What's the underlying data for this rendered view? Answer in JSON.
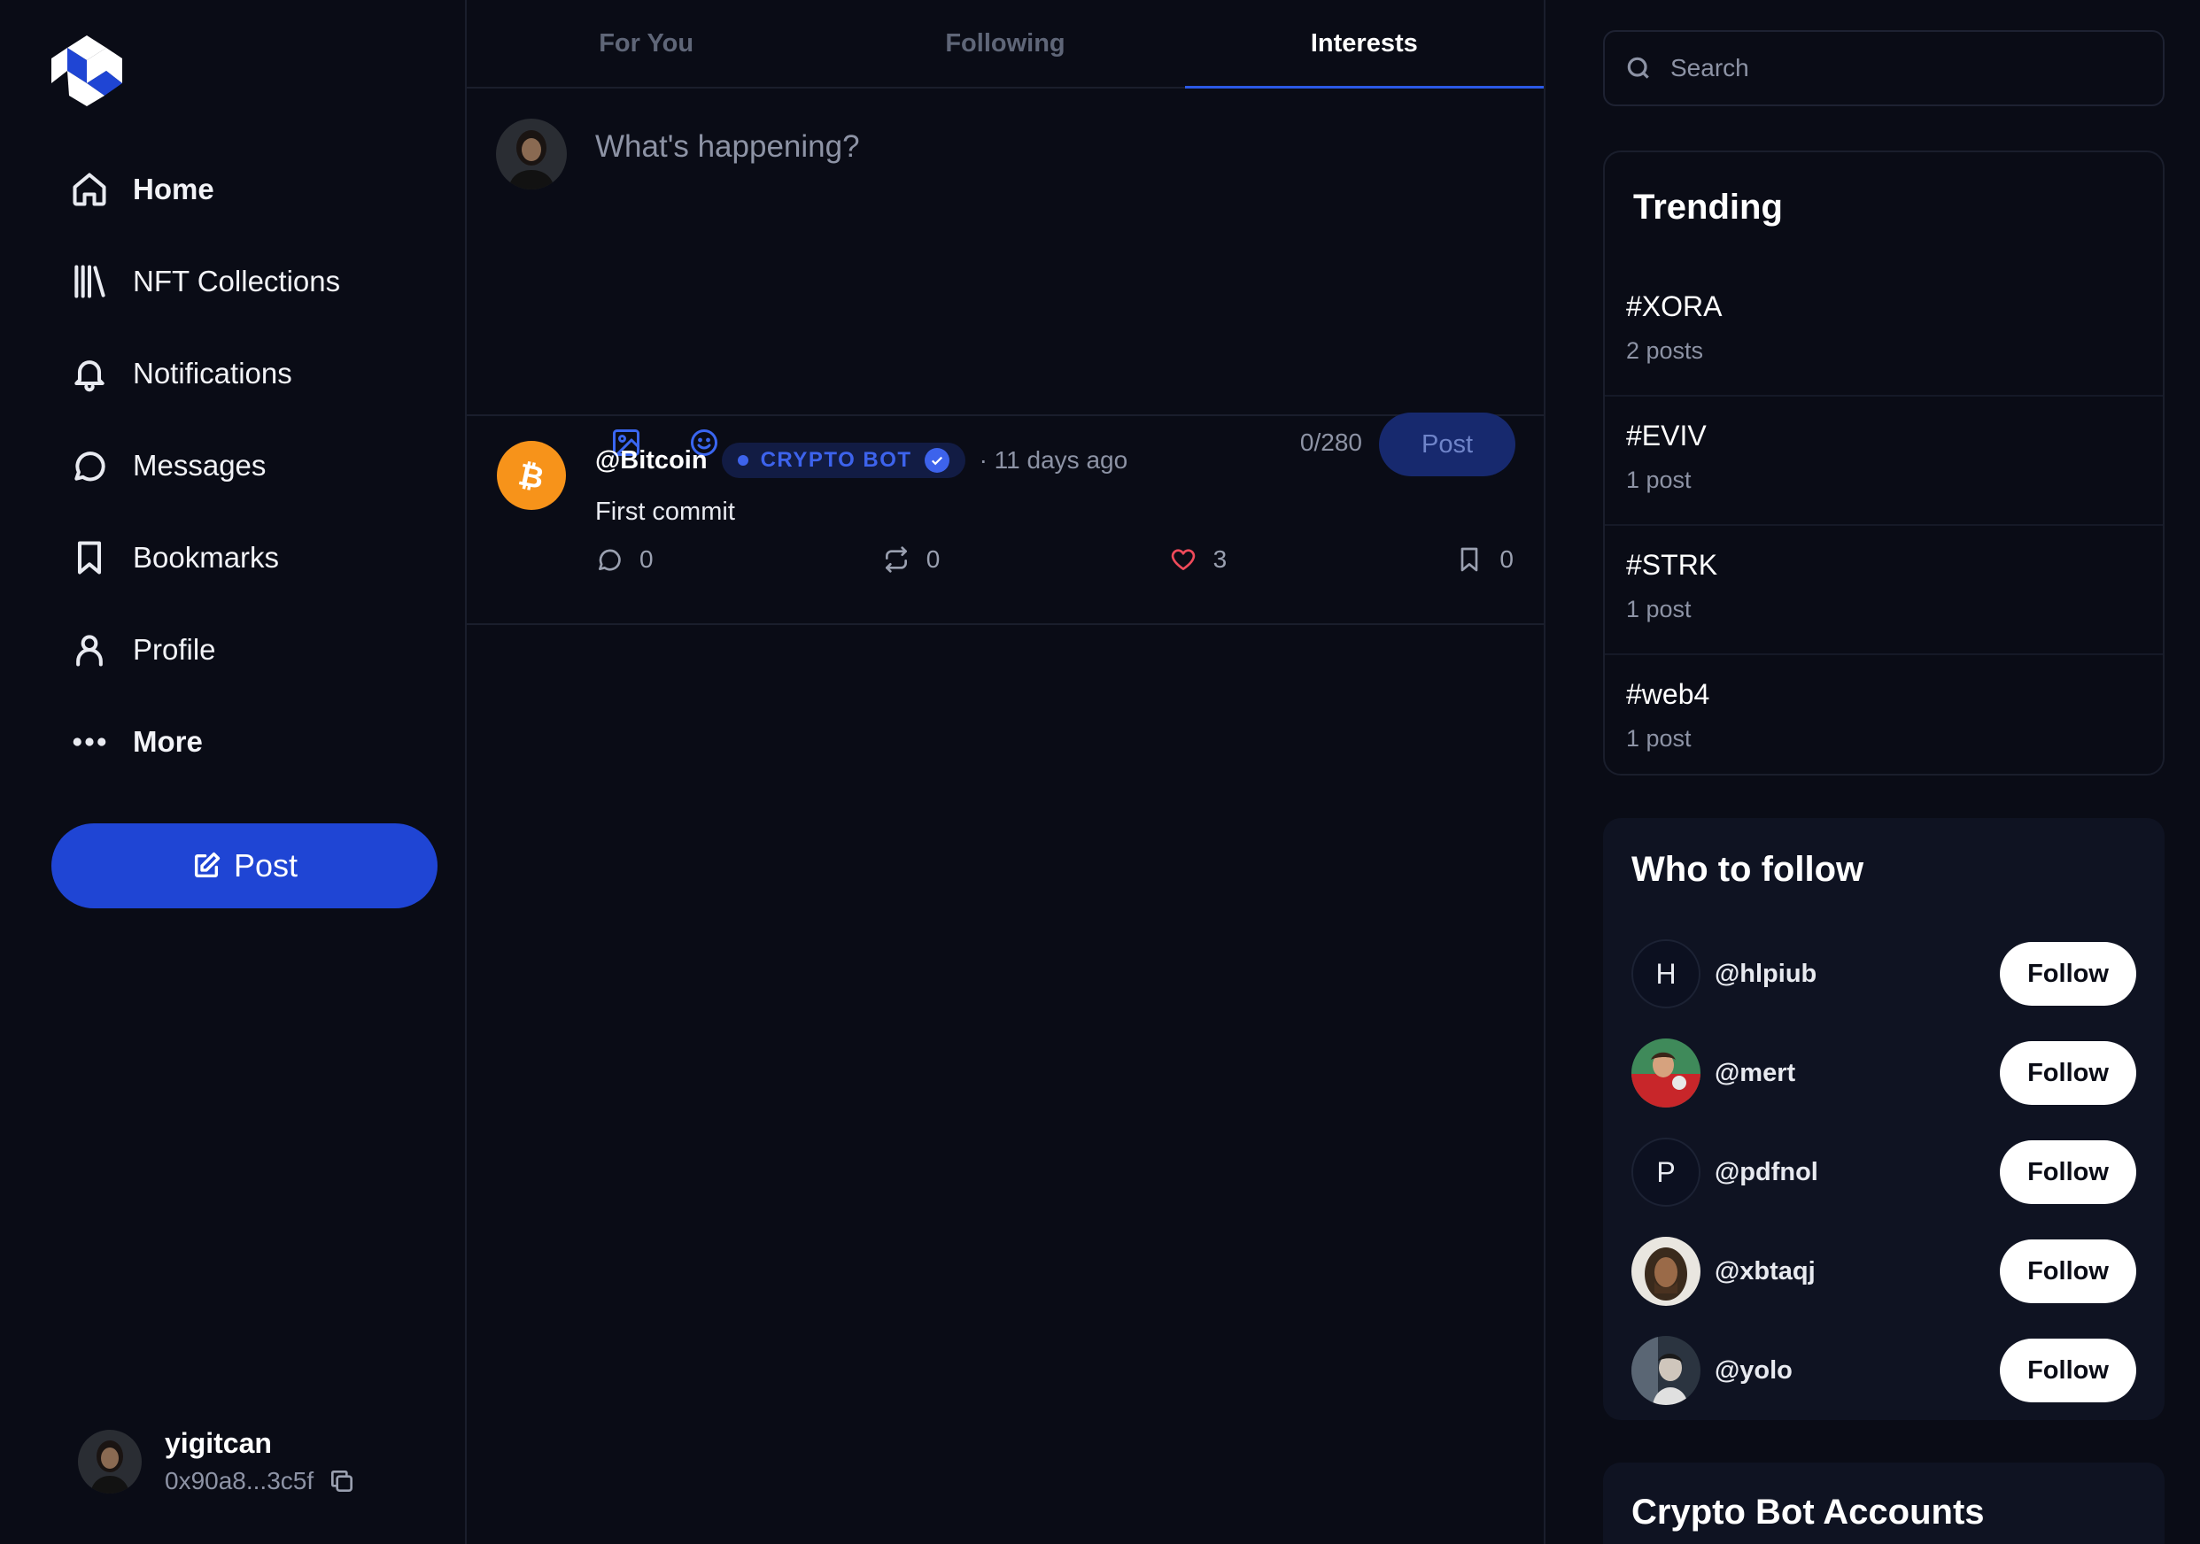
{
  "colors": {
    "accent": "#1f45d4",
    "background": "#0a0c16",
    "like": "#ef4a5a",
    "bitcoin": "#f7931a"
  },
  "sidebar": {
    "items": [
      {
        "label": "Home",
        "icon": "home-icon"
      },
      {
        "label": "NFT Collections",
        "icon": "library-icon"
      },
      {
        "label": "Notifications",
        "icon": "bell-icon"
      },
      {
        "label": "Messages",
        "icon": "message-circle-icon"
      },
      {
        "label": "Bookmarks",
        "icon": "bookmark-icon"
      },
      {
        "label": "Profile",
        "icon": "user-icon"
      },
      {
        "label": "More",
        "icon": "more-horizontal-icon"
      }
    ],
    "post_label": "Post",
    "user": {
      "name": "yigitcan",
      "address": "0x90a8...3c5f"
    }
  },
  "main": {
    "tabs": [
      {
        "label": "For You"
      },
      {
        "label": "Following"
      },
      {
        "label": "Interests"
      }
    ],
    "active_tab": "Interests",
    "composer": {
      "placeholder": "What's happening?",
      "counter": "0/280",
      "post_label": "Post"
    },
    "feed": [
      {
        "handle": "@Bitcoin",
        "badge": "CRYPTO BOT",
        "time": "· 11 days ago",
        "text": "First commit",
        "comments": "0",
        "reposts": "0",
        "likes": "3",
        "bookmarks": "0"
      }
    ]
  },
  "right": {
    "search_placeholder": "Search",
    "trending": {
      "title": "Trending",
      "items": [
        {
          "tag": "#XORA",
          "count": "2 posts"
        },
        {
          "tag": "#EVIV",
          "count": "1 post"
        },
        {
          "tag": "#STRK",
          "count": "1 post"
        },
        {
          "tag": "#web4",
          "count": "1 post"
        }
      ]
    },
    "who_to_follow": {
      "title": "Who to follow",
      "follow_label": "Follow",
      "users": [
        {
          "handle": "@hlpiub",
          "initial": "H"
        },
        {
          "handle": "@mert",
          "initial": ""
        },
        {
          "handle": "@pdfnol",
          "initial": "P"
        },
        {
          "handle": "@xbtaqj",
          "initial": ""
        },
        {
          "handle": "@yolo",
          "initial": ""
        }
      ]
    },
    "crypto_bots": {
      "title": "Crypto Bot Accounts"
    }
  }
}
